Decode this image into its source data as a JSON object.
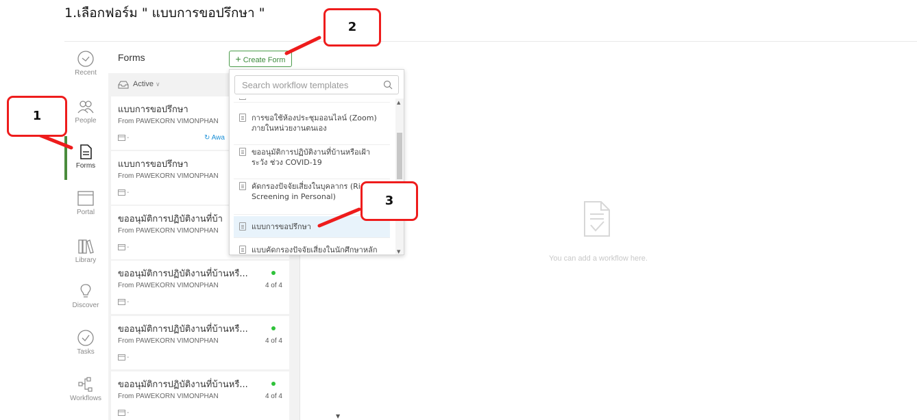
{
  "caption": "1.เลือกฟอร์ม \" แบบการขอปรึกษา \"",
  "sidebar": {
    "items": [
      {
        "label": "Recent",
        "icon": "clock-icon"
      },
      {
        "label": "People",
        "icon": "people-icon"
      },
      {
        "label": "Forms",
        "icon": "form-document-icon"
      },
      {
        "label": "Portal",
        "icon": "portal-window-icon"
      },
      {
        "label": "Library",
        "icon": "library-books-icon"
      },
      {
        "label": "Discover",
        "icon": "lightbulb-icon"
      },
      {
        "label": "Tasks",
        "icon": "check-circle-icon"
      },
      {
        "label": "Workflows",
        "icon": "workflow-icon"
      }
    ],
    "active": "Forms"
  },
  "forms_panel": {
    "title": "Forms",
    "create_button": "Create Form",
    "filter": "Active",
    "cards": [
      {
        "title": "แบบการขอปรึกษา",
        "from": "From PAWEKORN VIMONPHAN",
        "date": "-",
        "status": "Awa"
      },
      {
        "title": "แบบการขอปรึกษา",
        "from": "From PAWEKORN VIMONPHAN",
        "date": "-"
      },
      {
        "title": "ขออนุมัติการปฏิบัติงานที่บ้า",
        "from": "From PAWEKORN VIMONPHAN",
        "date": "-"
      },
      {
        "title": "ขออนุมัติการปฏิบัติงานที่บ้านหรื...",
        "from": "From PAWEKORN VIMONPHAN",
        "date": "-",
        "count": "4 of 4"
      },
      {
        "title": "ขออนุมัติการปฏิบัติงานที่บ้านหรื...",
        "from": "From PAWEKORN VIMONPHAN",
        "date": "-",
        "count": "4 of 4"
      },
      {
        "title": "ขออนุมัติการปฏิบัติงานที่บ้านหรื...",
        "from": "From PAWEKORN VIMONPHAN",
        "date": "-",
        "count": "4 of 4"
      }
    ]
  },
  "template_dropdown": {
    "search_placeholder": "Search workflow templates",
    "items": [
      "การขอใช้ห้องประชุมออนไลน์ (Zoom) ภายในหน่วยงานตนเอง",
      "ขออนุมัติการปฏิบัติงานที่บ้านหรือเฝ้าระวัง ช่วง COVID-19",
      "คัดกรองปัจจัยเสี่ยงในบุคลากร (Risk Screening in Personal)",
      "แบบการขอปรึกษา",
      "แบบคัดกรองปัจจัยเสี่ยงในนักศึกษาหลัก"
    ],
    "selected": "แบบการขอปรึกษา"
  },
  "empty_state": {
    "text": "You can add a workflow here.",
    "icon": "document-check-icon"
  },
  "callouts": [
    "1",
    "2",
    "3"
  ],
  "colors": {
    "accent_green": "#4a8c3c",
    "callout_red": "#ee1c1c",
    "status_dot": "#2fc23a",
    "link_blue": "#1a8fd6"
  }
}
